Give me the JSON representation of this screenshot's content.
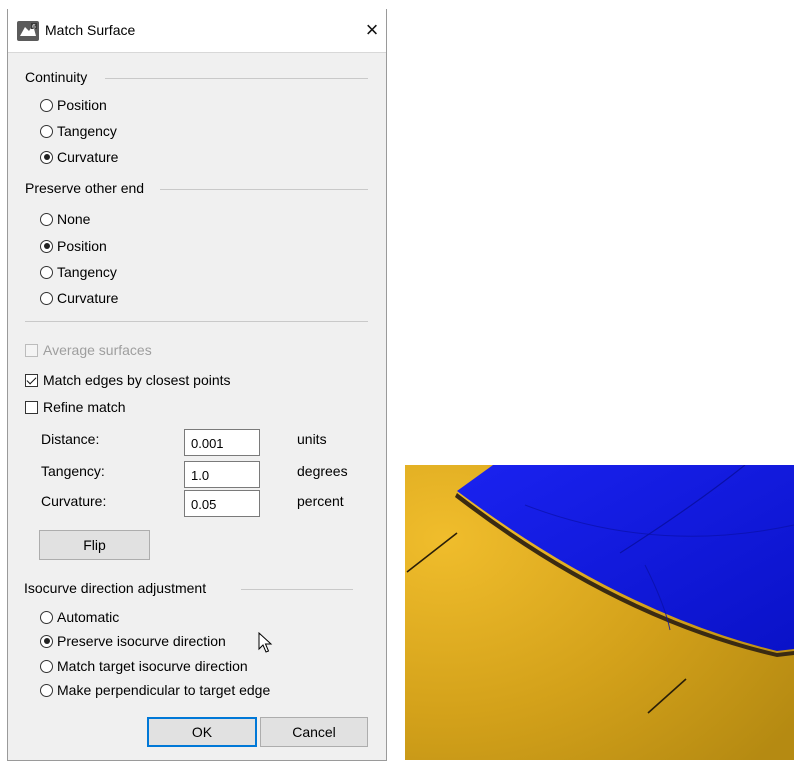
{
  "dialog": {
    "title": "Match Surface",
    "close_label": "×"
  },
  "continuity": {
    "label": "Continuity",
    "options": [
      {
        "label": "Position",
        "selected": false
      },
      {
        "label": "Tangency",
        "selected": false
      },
      {
        "label": "Curvature",
        "selected": true
      }
    ]
  },
  "preserve": {
    "label": "Preserve other end",
    "options": [
      {
        "label": "None",
        "selected": false
      },
      {
        "label": "Position",
        "selected": true
      },
      {
        "label": "Tangency",
        "selected": false
      },
      {
        "label": "Curvature",
        "selected": false
      }
    ]
  },
  "checks": {
    "average": {
      "label": "Average surfaces",
      "checked": false,
      "enabled": false
    },
    "match_edges": {
      "label": "Match edges by closest points",
      "checked": true
    },
    "refine": {
      "label": "Refine match",
      "checked": false
    }
  },
  "tolerances": {
    "distance": {
      "label": "Distance:",
      "value": "0.001",
      "unit": "units"
    },
    "tangency": {
      "label": "Tangency:",
      "value": "1.0",
      "unit": "degrees"
    },
    "curvature": {
      "label": "Curvature:",
      "value": "0.05",
      "unit": "percent"
    }
  },
  "flip_label": "Flip",
  "isocurve": {
    "label": "Isocurve direction adjustment",
    "options": [
      {
        "label": "Automatic",
        "selected": false
      },
      {
        "label": "Preserve isocurve direction",
        "selected": true
      },
      {
        "label": "Match target isocurve direction",
        "selected": false
      },
      {
        "label": "Make perpendicular to target edge",
        "selected": false
      }
    ]
  },
  "buttons": {
    "ok": "OK",
    "cancel": "Cancel"
  },
  "colors": {
    "surface_blue": "#0a14e6",
    "surface_yellow": "#d8a216"
  }
}
